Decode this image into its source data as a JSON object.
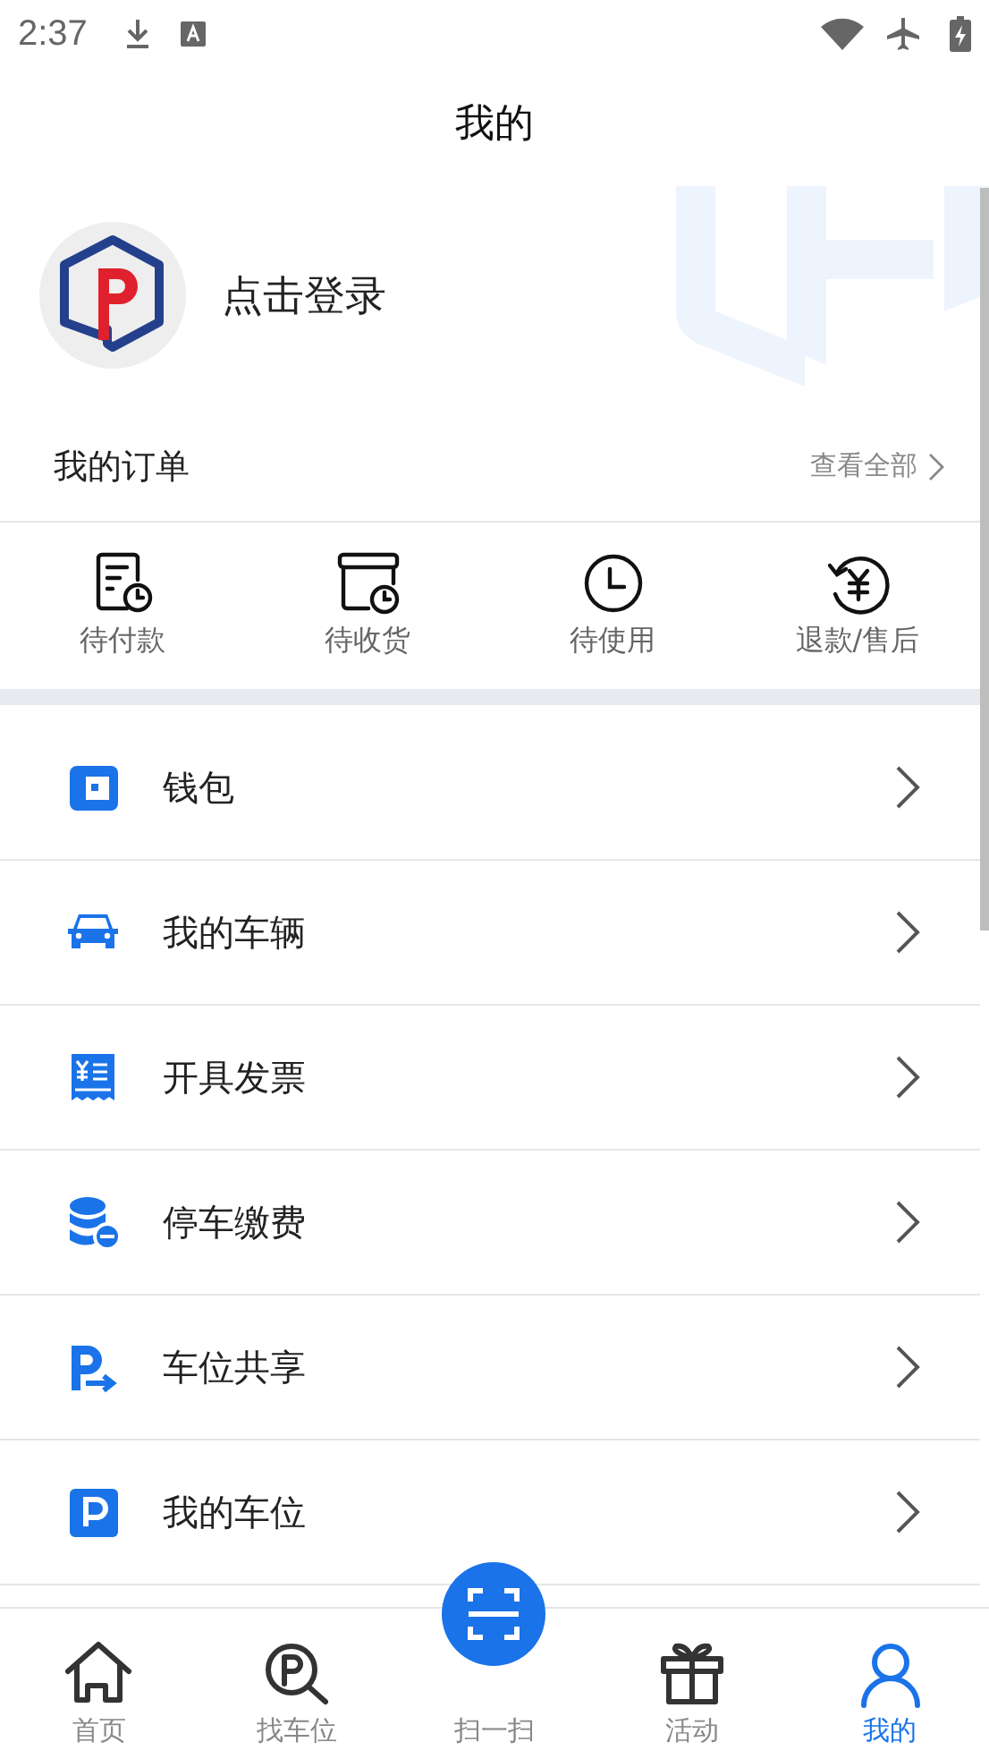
{
  "status_bar": {
    "time": "2:37"
  },
  "header": {
    "title": "我的"
  },
  "profile": {
    "login_text": "点击登录"
  },
  "orders": {
    "title": "我的订单",
    "view_all": "查看全部",
    "items": [
      {
        "label": "待付款",
        "kind": "pay"
      },
      {
        "label": "待收货",
        "kind": "receive"
      },
      {
        "label": "待使用",
        "kind": "use"
      },
      {
        "label": "退款/售后",
        "kind": "refund"
      }
    ]
  },
  "menu": [
    {
      "label": "钱包",
      "kind": "wallet"
    },
    {
      "label": "我的车辆",
      "kind": "car"
    },
    {
      "label": "开具发票",
      "kind": "invoice"
    },
    {
      "label": "停车缴费",
      "kind": "fee"
    },
    {
      "label": "车位共享",
      "kind": "share"
    },
    {
      "label": "我的车位",
      "kind": "spot"
    }
  ],
  "tabs": [
    {
      "label": "首页",
      "kind": "home",
      "selected": false
    },
    {
      "label": "找车位",
      "kind": "find",
      "selected": false
    },
    {
      "label": "扫一扫",
      "kind": "scan",
      "selected": false
    },
    {
      "label": "活动",
      "kind": "gift",
      "selected": false
    },
    {
      "label": "我的",
      "kind": "user",
      "selected": true
    }
  ]
}
